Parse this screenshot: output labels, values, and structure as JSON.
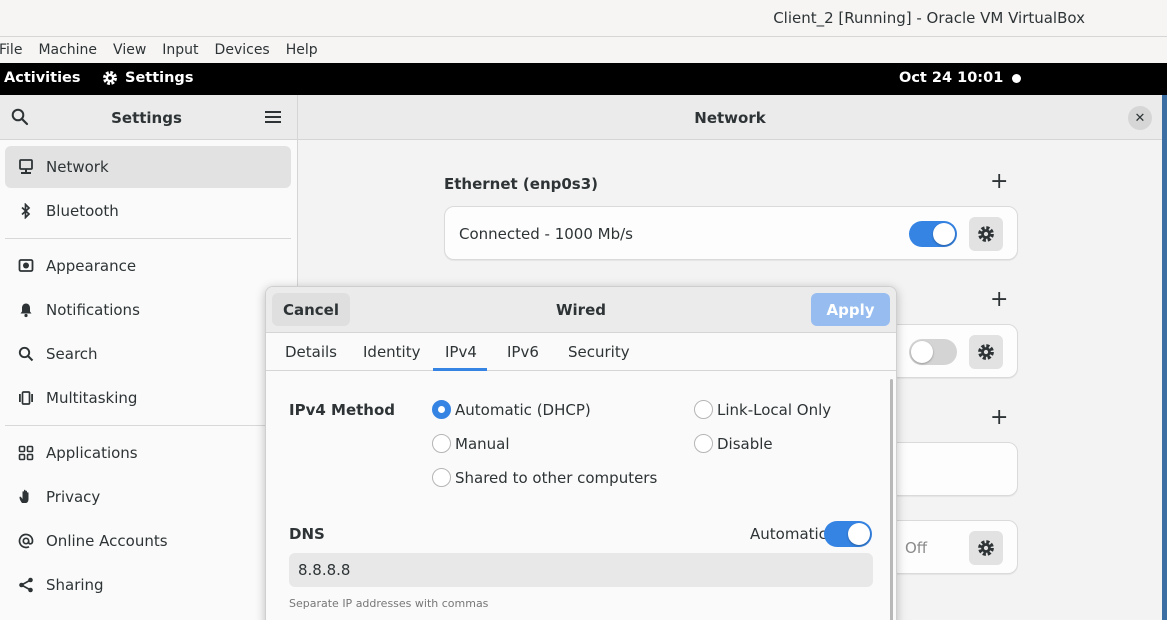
{
  "vbox": {
    "title": "Client_2 [Running] - Oracle VM VirtualBox",
    "menu": [
      "File",
      "Machine",
      "View",
      "Input",
      "Devices",
      "Help"
    ]
  },
  "topbar": {
    "activities": "Activities",
    "app_name": "Settings",
    "clock": "Oct 24  10:01"
  },
  "sidebar": {
    "title": "Settings",
    "items": [
      {
        "label": "Network",
        "icon": "network-icon"
      },
      {
        "label": "Bluetooth",
        "icon": "bluetooth-icon"
      },
      {
        "label": "Appearance",
        "icon": "appearance-icon"
      },
      {
        "label": "Notifications",
        "icon": "bell-icon"
      },
      {
        "label": "Search",
        "icon": "search-icon"
      },
      {
        "label": "Multitasking",
        "icon": "multitasking-icon"
      },
      {
        "label": "Applications",
        "icon": "grid-icon"
      },
      {
        "label": "Privacy",
        "icon": "hand-icon"
      },
      {
        "label": "Online Accounts",
        "icon": "at-icon"
      },
      {
        "label": "Sharing",
        "icon": "share-icon"
      }
    ]
  },
  "main": {
    "title": "Network",
    "ethernet_title": "Ethernet (enp0s3)",
    "ethernet_status": "Connected - 1000 Mb/s",
    "off_label": "Off"
  },
  "dialog": {
    "title": "Wired",
    "cancel": "Cancel",
    "apply": "Apply",
    "tabs": [
      "Details",
      "Identity",
      "IPv4",
      "IPv6",
      "Security"
    ],
    "active_tab": "IPv4",
    "method_label": "IPv4 Method",
    "methods": {
      "automatic": "Automatic (DHCP)",
      "manual": "Manual",
      "shared": "Shared to other computers",
      "link_local": "Link-Local Only",
      "disable": "Disable"
    },
    "selected_method": "Automatic (DHCP)",
    "dns_label": "DNS",
    "dns_automatic_label": "Automatic",
    "dns_automatic": true,
    "dns_value": "8.8.8.8",
    "dns_hint": "Separate IP addresses with commas"
  },
  "colors": {
    "accent": "#3584e4",
    "apply_disabled": "#97bdf0"
  }
}
